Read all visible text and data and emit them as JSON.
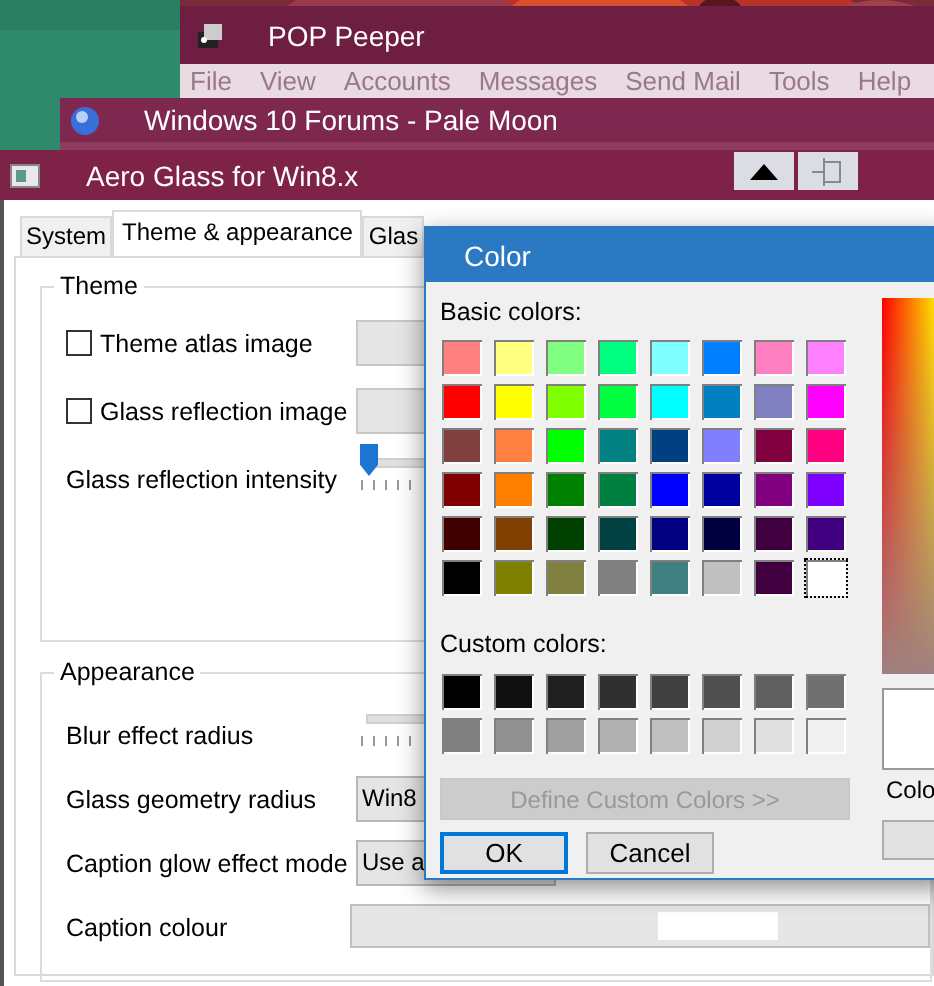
{
  "pop_peeper": {
    "title": "POP Peeper",
    "menu": [
      "File",
      "View",
      "Accounts",
      "Messages",
      "Send Mail",
      "Tools",
      "Help"
    ]
  },
  "pale_moon": {
    "title": "Windows 10 Forums - Pale Moon"
  },
  "aero_glass": {
    "title": "Aero Glass for Win8.x",
    "tabs": [
      {
        "label": "System",
        "selected": false
      },
      {
        "label": "Theme & appearance",
        "selected": true
      },
      {
        "label": "Glas",
        "selected": false
      }
    ],
    "groups": [
      {
        "title": "Theme",
        "rows": [
          {
            "kind": "checkbox",
            "label": "Theme atlas image",
            "checked": false
          },
          {
            "kind": "checkbox",
            "label": "Glass reflection image",
            "checked": false
          },
          {
            "kind": "slider",
            "label": "Glass reflection intensity",
            "level": 0
          }
        ]
      },
      {
        "title": "Appearance",
        "rows": [
          {
            "kind": "slider",
            "label": "Blur effect radius"
          },
          {
            "kind": "combo",
            "label": "Glass geometry radius",
            "value": "Win8"
          },
          {
            "kind": "combo",
            "label": "Caption glow effect mode",
            "value": "Use a"
          },
          {
            "kind": "colour",
            "label": "Caption colour"
          }
        ]
      }
    ]
  },
  "color_dialog": {
    "title": "Color",
    "basic_label": "Basic colors:",
    "basic": [
      [
        {
          "color": "#ff8080",
          "selected": false
        },
        {
          "color": "#ffff80",
          "selected": false
        },
        {
          "color": "#80ff80",
          "selected": false
        },
        {
          "color": "#00ff80",
          "selected": false
        },
        {
          "color": "#80ffff",
          "selected": false
        },
        {
          "color": "#0080ff",
          "selected": false
        },
        {
          "color": "#ff80c0",
          "selected": false
        },
        {
          "color": "#ff80ff",
          "selected": false
        }
      ],
      [
        {
          "color": "#ff0000",
          "selected": false
        },
        {
          "color": "#ffff00",
          "selected": false
        },
        {
          "color": "#80ff00",
          "selected": false
        },
        {
          "color": "#00ff40",
          "selected": false
        },
        {
          "color": "#00ffff",
          "selected": false
        },
        {
          "color": "#0080c0",
          "selected": false
        },
        {
          "color": "#8080c0",
          "selected": false
        },
        {
          "color": "#ff00ff",
          "selected": false
        }
      ],
      [
        {
          "color": "#804040",
          "selected": false
        },
        {
          "color": "#ff8040",
          "selected": false
        },
        {
          "color": "#00ff00",
          "selected": false
        },
        {
          "color": "#008080",
          "selected": false
        },
        {
          "color": "#004080",
          "selected": false
        },
        {
          "color": "#8080ff",
          "selected": false
        },
        {
          "color": "#800040",
          "selected": false
        },
        {
          "color": "#ff0080",
          "selected": false
        }
      ],
      [
        {
          "color": "#800000",
          "selected": false
        },
        {
          "color": "#ff8000",
          "selected": false
        },
        {
          "color": "#008000",
          "selected": false
        },
        {
          "color": "#008040",
          "selected": false
        },
        {
          "color": "#0000ff",
          "selected": false
        },
        {
          "color": "#0000a0",
          "selected": false
        },
        {
          "color": "#800080",
          "selected": false
        },
        {
          "color": "#8000ff",
          "selected": false
        }
      ],
      [
        {
          "color": "#400000",
          "selected": false
        },
        {
          "color": "#804000",
          "selected": false
        },
        {
          "color": "#004000",
          "selected": false
        },
        {
          "color": "#004040",
          "selected": false
        },
        {
          "color": "#000080",
          "selected": false
        },
        {
          "color": "#000040",
          "selected": false
        },
        {
          "color": "#400040",
          "selected": false
        },
        {
          "color": "#400080",
          "selected": false
        }
      ],
      [
        {
          "color": "#000000",
          "selected": false
        },
        {
          "color": "#808000",
          "selected": false
        },
        {
          "color": "#808040",
          "selected": false
        },
        {
          "color": "#808080",
          "selected": false
        },
        {
          "color": "#408080",
          "selected": false
        },
        {
          "color": "#c0c0c0",
          "selected": false
        },
        {
          "color": "#400040",
          "selected": false
        },
        {
          "color": "#ffffff",
          "selected": true
        }
      ]
    ],
    "custom_label": "Custom colors:",
    "custom": [
      [
        {
          "color": "#000000"
        },
        {
          "color": "#101010"
        },
        {
          "color": "#202020"
        },
        {
          "color": "#303030"
        },
        {
          "color": "#404040"
        },
        {
          "color": "#505050"
        },
        {
          "color": "#606060"
        },
        {
          "color": "#707070"
        }
      ],
      [
        {
          "color": "#808080"
        },
        {
          "color": "#909090"
        },
        {
          "color": "#a0a0a0"
        },
        {
          "color": "#b0b0b0"
        },
        {
          "color": "#c0c0c0"
        },
        {
          "color": "#d0d0d0"
        },
        {
          "color": "#e0e0e0"
        },
        {
          "color": "#f0f0f0"
        }
      ]
    ],
    "define_button": {
      "label": "Define Custom Colors >>",
      "disabled": true
    },
    "buttons": [
      {
        "label": "OK",
        "default": true
      },
      {
        "label": "Cancel",
        "default": false
      }
    ],
    "color_label": "Colo"
  }
}
